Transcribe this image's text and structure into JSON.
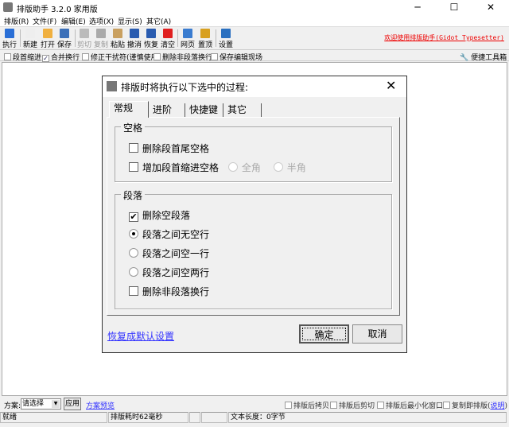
{
  "window": {
    "title": "排版助手 3.2.0 家用版",
    "minimize": "─",
    "maximize": "☐",
    "close": "✕"
  },
  "menu": [
    "排版(R)",
    "文件(F)",
    "编辑(E)",
    "选项(X)",
    "显示(S)",
    "其它(A)"
  ],
  "toolbar": [
    {
      "label": "执行",
      "icon": "play-icon",
      "color": "#2a6fd6",
      "enabled": true
    },
    {
      "label": "新建",
      "icon": "new-file-icon",
      "color": "#eee",
      "enabled": true
    },
    {
      "label": "打开",
      "icon": "open-folder-icon",
      "color": "#f0b040",
      "enabled": true
    },
    {
      "label": "保存",
      "icon": "save-icon",
      "color": "#3b6fb8",
      "enabled": true
    },
    {
      "label": "剪切",
      "icon": "cut-icon",
      "color": "#bbb",
      "enabled": false
    },
    {
      "label": "复制",
      "icon": "copy-icon",
      "color": "#aaa",
      "enabled": false
    },
    {
      "label": "粘贴",
      "icon": "paste-icon",
      "color": "#c9a060",
      "enabled": true
    },
    {
      "label": "撤消",
      "icon": "undo-icon",
      "color": "#2a5cb0",
      "enabled": true
    },
    {
      "label": "恢复",
      "icon": "redo-icon",
      "color": "#2a5cb0",
      "enabled": true
    },
    {
      "label": "清空",
      "icon": "clear-icon",
      "color": "#e02020",
      "enabled": true
    },
    {
      "label": "网页",
      "icon": "web-icon",
      "color": "#3a7cd0",
      "enabled": true
    },
    {
      "label": "置顶",
      "icon": "pin-icon",
      "color": "#d8a020",
      "enabled": true
    },
    {
      "label": "设置",
      "icon": "settings-icon",
      "color": "#2a70c0",
      "enabled": true
    }
  ],
  "welcome": "欢迎使用排版助手(Gidot Typesetter)",
  "options": [
    {
      "label": "段首缩进",
      "checked": false
    },
    {
      "label": "合并换行",
      "checked": true
    },
    {
      "label": "修正干扰符(谨慎使用)",
      "checked": false
    },
    {
      "label": "删除非段落换行",
      "checked": false
    },
    {
      "label": "保存编辑现场",
      "checked": false
    }
  ],
  "toolbox": "便捷工具箱",
  "dialog": {
    "title": "排版时将执行以下选中的过程:",
    "tabs": [
      "常规",
      "进阶",
      "快捷键",
      "其它"
    ],
    "group_space": {
      "label": "空格",
      "trim": "删除段首尾空格",
      "indent": "增加段首缩进空格",
      "full": "全角",
      "half": "半角"
    },
    "group_para": {
      "label": "段落",
      "remove_empty": "删除空段落",
      "no_blank": "段落之间无空行",
      "one_blank": "段落之间空一行",
      "two_blank": "段落之间空两行",
      "remove_nonpara": "删除非段落换行"
    },
    "restore_link": "恢复成默认设置",
    "ok": "确定",
    "cancel": "取消"
  },
  "bottom": {
    "scheme_label": "方案:",
    "scheme_value": "请选择",
    "apply": "应用",
    "scheme_link": "方案预览",
    "checks": [
      "排版后拷贝",
      "排版后剪切",
      "排版后最小化窗口",
      "复制即排版("
    ],
    "help": "说明",
    "help_close": ")"
  },
  "status": {
    "ready": "就绪",
    "time": "排版耗时62毫秒",
    "length": "文本长度：0字节"
  }
}
